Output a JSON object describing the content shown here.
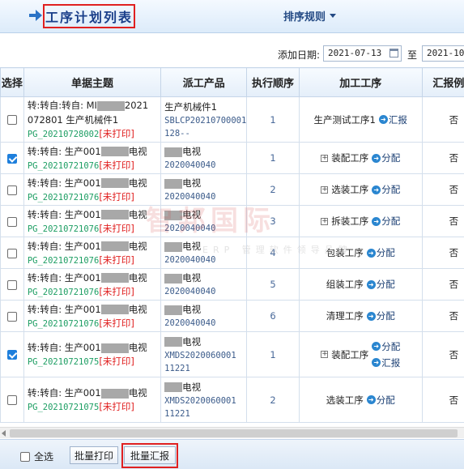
{
  "header": {
    "title": "工序计划列表",
    "sort_label": "排序规则"
  },
  "filter": {
    "date_label": "添加日期:",
    "date_from": "2021-07-13",
    "to_label": "至",
    "date_to": "2021-10-"
  },
  "columns": [
    "选择",
    "单据主题",
    "派工产品",
    "执行顺序",
    "加工工序",
    "汇报例外"
  ],
  "rows": [
    {
      "checked": false,
      "subject": "转:转自:转自: MI",
      "subject_tail": "2021",
      "subject_b": "072801 生产机械件1",
      "code": "PG_20210728002",
      "noprint": "[未打印]",
      "product": "生产机械件1",
      "product_code": "SBLCP20210700001",
      "product_code2": "128--",
      "order": "1",
      "process": "生产测试工序1",
      "actions": [
        "汇报"
      ],
      "expand": false,
      "report": "否"
    },
    {
      "checked": true,
      "subject": "转:转自: 生产001",
      "subject_tail": "电视",
      "code": "PG_20210721076",
      "noprint": "[未打印]",
      "product": "电视",
      "product_code": "2020040040",
      "order": "1",
      "process": "装配工序",
      "actions": [
        "分配"
      ],
      "expand": true,
      "report": "否"
    },
    {
      "checked": false,
      "subject": "转:转自: 生产001",
      "subject_tail": "电视",
      "code": "PG_20210721076",
      "noprint": "[未打印]",
      "product": "电视",
      "product_code": "2020040040",
      "order": "2",
      "process": "选装工序",
      "actions": [
        "分配"
      ],
      "expand": true,
      "report": "否"
    },
    {
      "checked": false,
      "subject": "转:转自: 生产001",
      "subject_tail": "电视",
      "code": "PG_20210721076",
      "noprint": "[未打印]",
      "product": "电视",
      "product_code": "2020040040",
      "order": "3",
      "process": "拆装工序",
      "actions": [
        "分配"
      ],
      "expand": true,
      "report": "否"
    },
    {
      "checked": false,
      "subject": "转:转自: 生产001",
      "subject_tail": "电视",
      "code": "PG_20210721076",
      "noprint": "[未打印]",
      "product": "电视",
      "product_code": "2020040040",
      "order": "4",
      "process": "包装工序",
      "actions": [
        "分配"
      ],
      "expand": false,
      "report": "否"
    },
    {
      "checked": false,
      "subject": "转:转自: 生产001",
      "subject_tail": "电视",
      "code": "PG_20210721076",
      "noprint": "[未打印]",
      "product": "电视",
      "product_code": "2020040040",
      "order": "5",
      "process": "组装工序",
      "actions": [
        "分配"
      ],
      "expand": false,
      "report": "否"
    },
    {
      "checked": false,
      "subject": "转:转自: 生产001",
      "subject_tail": "电视",
      "code": "PG_20210721076",
      "noprint": "[未打印]",
      "product": "电视",
      "product_code": "2020040040",
      "order": "6",
      "process": "清理工序",
      "actions": [
        "分配"
      ],
      "expand": false,
      "report": "否"
    },
    {
      "checked": true,
      "subject": "转:转自: 生产001",
      "subject_tail": "电视",
      "code": "PG_20210721075",
      "noprint": "[未打印]",
      "product": "电视",
      "product_code": "XMDS2020060001",
      "product_code2": "11221",
      "order": "1",
      "process": "装配工序",
      "actions": [
        "分配",
        "汇报"
      ],
      "expand": true,
      "report": "否"
    },
    {
      "checked": false,
      "subject": "转:转自: 生产001",
      "subject_tail": "电视",
      "code": "PG_20210721075",
      "noprint": "[未打印]",
      "product": "电视",
      "product_code": "XMDS2020060001",
      "product_code2": "11221",
      "order": "2",
      "process": "选装工序",
      "actions": [
        "分配"
      ],
      "expand": false,
      "report": "否"
    }
  ],
  "footer": {
    "select_all_label": "全选",
    "batch_print_label": "批量打印",
    "batch_report_label": "批量汇报"
  },
  "watermark": {
    "main": "智邦国际",
    "sub": "ERP 管理软件领导品牌"
  },
  "colors": {
    "accent_red": "#e02020",
    "code_green": "#1d9e63",
    "title_blue": "#1a3f8a"
  }
}
